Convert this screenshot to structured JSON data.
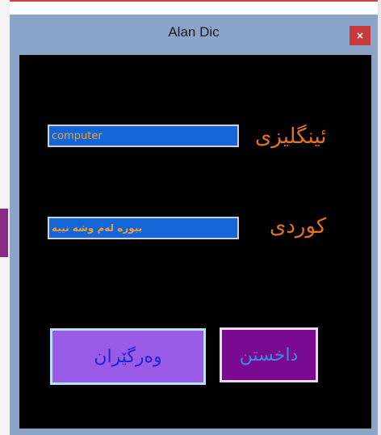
{
  "window": {
    "title": "Alan Dic",
    "close_symbol": "×"
  },
  "form": {
    "english_label": "ئینگلیزی",
    "english_value": "computer",
    "kurdish_label": "کوردی",
    "kurdish_value": "ببورە لەم وشە نییە"
  },
  "buttons": {
    "translate_label": "وەرگێران",
    "exit_label": "داخستن"
  },
  "colors": {
    "titlebar": "#8aa4c8",
    "client_background": "#000000",
    "input_background": "#1466d8",
    "input_text": "#f0a030",
    "label_text": "#e0702a",
    "translate_button": "#9a5ae8",
    "exit_button": "#7a0a90",
    "close_button": "#c83a3a"
  },
  "icons": {
    "close": "close-icon"
  }
}
